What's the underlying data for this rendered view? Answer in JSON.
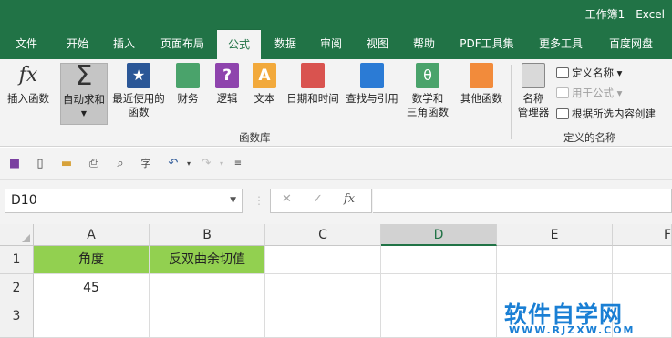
{
  "titlebar": {
    "title": "工作簿1  -  Excel"
  },
  "tabs": [
    {
      "label": "文件"
    },
    {
      "label": "开始"
    },
    {
      "label": "插入"
    },
    {
      "label": "页面布局"
    },
    {
      "label": "公式"
    },
    {
      "label": "数据"
    },
    {
      "label": "审阅"
    },
    {
      "label": "视图"
    },
    {
      "label": "帮助"
    },
    {
      "label": "PDF工具集"
    },
    {
      "label": "更多工具"
    },
    {
      "label": "百度网盘"
    }
  ],
  "ribbon": {
    "insert_function": "插入函数",
    "autosum": "自动求和",
    "recent_line1": "最近使用的",
    "recent_line2": "函数",
    "financial": "财务",
    "logical": "逻辑",
    "text": "文本",
    "datetime": "日期和时间",
    "lookup": "查找与引用",
    "math_line1": "数学和",
    "math_line2": "三角函数",
    "more": "其他函数",
    "library_group": "函数库",
    "name_manager_line1": "名称",
    "name_manager_line2": "管理器",
    "define_name": "定义名称",
    "use_in_formula": "用于公式",
    "create_from_selection": "根据所选内容创建",
    "defined_names_group": "定义的名称"
  },
  "formula_bar": {
    "name_box": "D10",
    "cancel": "✕",
    "enter": "✓",
    "fx": "fx",
    "value": ""
  },
  "grid": {
    "columns": [
      "A",
      "B",
      "C",
      "D",
      "E",
      "F"
    ],
    "rows": [
      "1",
      "2",
      "3"
    ],
    "cells": {
      "A1": "角度",
      "B1": "反双曲余切值",
      "A2": "45"
    }
  },
  "watermark": {
    "main": "软件自学网",
    "sub": "WWW.RJZXW.COM"
  },
  "colors": {
    "accent": "#217346",
    "header_fill": "#92d050"
  }
}
